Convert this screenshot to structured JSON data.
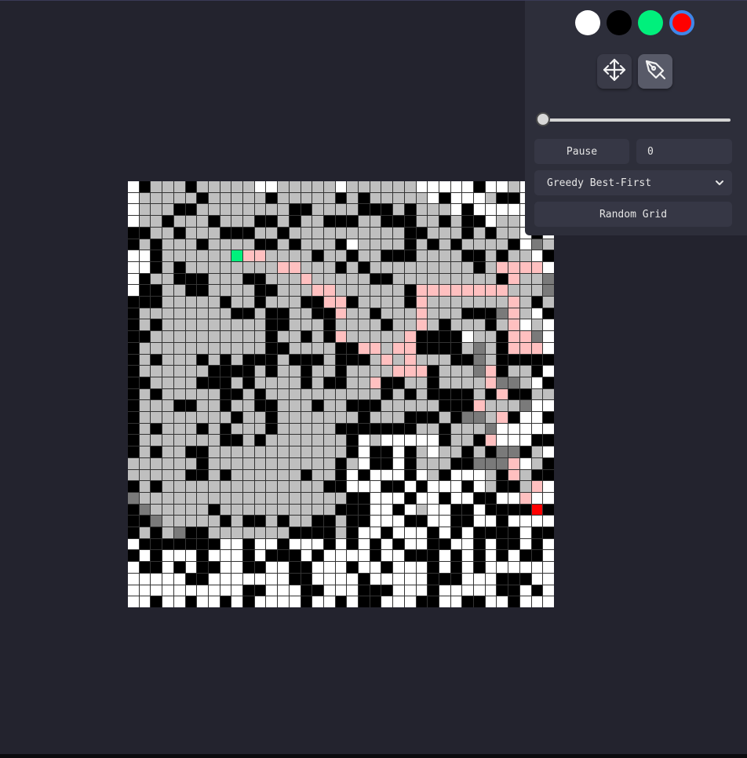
{
  "colors": {
    "background": "#23232e",
    "panel": "#2d2e3a",
    "empty": "#ffffff",
    "wall": "#000000",
    "visited": "#bfbfbf",
    "frontier": "#7a7a7a",
    "path": "#ffc0c0",
    "start": "#00f07c",
    "end": "#ff0000"
  },
  "palette": [
    {
      "name": "empty",
      "color": "#ffffff"
    },
    {
      "name": "wall",
      "color": "#000000"
    },
    {
      "name": "start",
      "color": "#00f07c"
    },
    {
      "name": "end",
      "color": "#ff0000",
      "selected": true
    }
  ],
  "tools": [
    {
      "name": "move-icon",
      "active": false
    },
    {
      "name": "pen-icon",
      "active": true
    }
  ],
  "speed": {
    "value": 0
  },
  "controls": {
    "pause_label": "Pause",
    "step_count": "0",
    "algorithm": "Greedy Best-First",
    "random_grid_label": "Random Grid"
  },
  "grid": {
    "size": 37,
    "legend": "0=empty,1=wall,2=visited,3=frontier,4=path,5=start,6=end",
    "rows": [
      "0122212222200222220222222000001002000",
      "0222221222221222221212222201000211010",
      "0222112222222211222211121222010000010",
      "0221222122211212211122111221211022010",
      "1122122211122122222222221122212122010",
      "1212221222211212221022221212122221032",
      "0012222225442222122122111222211212201",
      "0012122222222442221212222222221244440",
      "0122111222112224222221122222222214223",
      "0112211222211222442222221444444442223",
      "1112222212212221144122221422222224212",
      "1222222221121122114221222422211134201",
      "1212222222221122212222122421222124020",
      "1122222222221221214222224111102214430",
      "1222222222221122221144244111123214440",
      "1212221212111211121112424222113211111",
      "1222222111121221221222244412223412210",
      "1122221112122221211224112212222433201",
      "1212222211212222222222121211112141122",
      "1222112212211222122111222221114222300",
      "1222222221221222222212221112133241001",
      "1212221212221222221111111221222300000",
      "1222222211212222222102000001221400011",
      "1212211222222222222101101202212133120",
      "2222221222222222221201101222113334021",
      "2222211212222221221010001021000214211",
      "1212222222222222211000110100010211240",
      "3222222222222222222110001001001100400",
      "1322222122222222221110010200110111161",
      "1132222212112122112110001100110010000",
      "1212311222222211112100100010101111011",
      "0111111100100100010101010011001011010",
      "1010001000101110100001001110101010110",
      "0110101100110011000100100010101000000",
      "0000011000000011000010000011100011100",
      "0000000000110001100011100010000011010",
      "0010010010100001001011000110011001000"
    ]
  }
}
